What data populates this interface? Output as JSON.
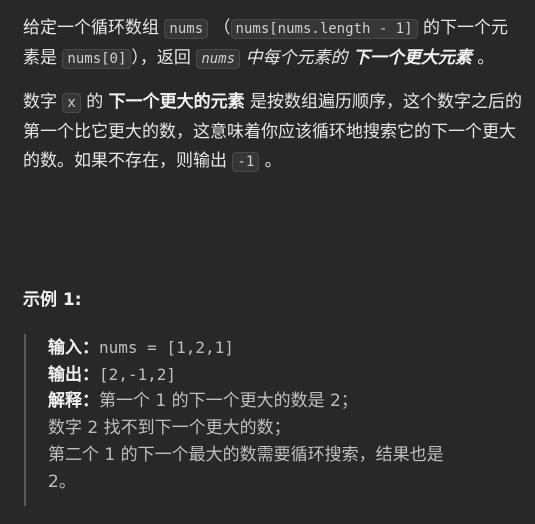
{
  "problem": {
    "p1": {
      "t1": "给定一个循环数组 ",
      "code_nums": "nums",
      "t2": " （",
      "code_last": "nums[nums.length - 1]",
      "t3": " 的下一个元素是 ",
      "code_first": "nums[0]",
      "t4": "），返回 ",
      "code_nums_it": "nums",
      "t5": " 中每个元素的 ",
      "bold_next": "下一个更大元素",
      "t6": " 。"
    },
    "p2": {
      "t1": "数字 ",
      "code_x": "x",
      "t2": " 的 ",
      "bold": "下一个更大的元素",
      "t3": " 是按数组遍历顺序，这个数字之后的第一个比它更大的数，这意味着你应该循环地搜索它的下一个更大的数。如果不存在，则输出 ",
      "code_neg": "-1",
      "t4": " 。"
    }
  },
  "example": {
    "title": "示例 1:",
    "input_label": "输入：",
    "input_value": "nums = [1,2,1]",
    "output_label": "输出：",
    "output_value": "[2,-1,2]",
    "explain_label": "解释：",
    "explain_line1": "第一个 1 的下一个更大的数是 2；",
    "explain_line2": "数字 2 找不到下一个更大的数；",
    "explain_line3": "第二个 1 的下一个最大的数需要循环搜索，结果也是",
    "explain_line4": "2。"
  }
}
